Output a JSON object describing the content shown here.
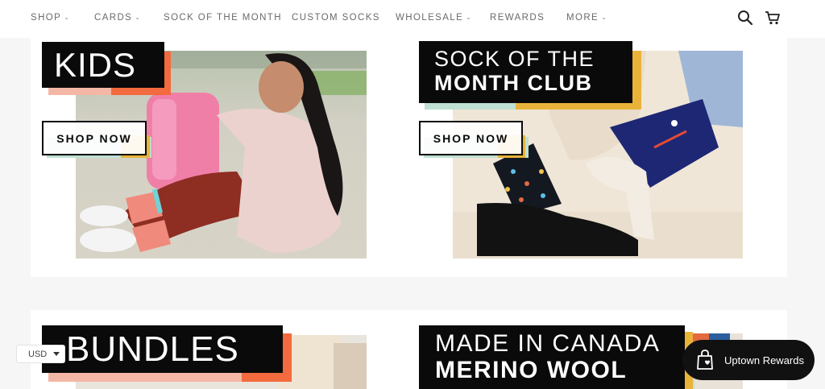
{
  "nav": {
    "items": [
      {
        "label": "SHOP",
        "dropdown": true
      },
      {
        "label": "CARDS",
        "dropdown": true
      },
      {
        "label": "SOCK OF THE MONTH",
        "dropdown": false
      },
      {
        "label": "CUSTOM SOCKS",
        "dropdown": false
      },
      {
        "label": "WHOLESALE",
        "dropdown": true
      },
      {
        "label": "REWARDS",
        "dropdown": false
      },
      {
        "label": "MORE",
        "dropdown": true
      }
    ],
    "icons": [
      "search-icon",
      "cart-icon"
    ]
  },
  "tiles": {
    "kids": {
      "title": "KIDS",
      "cta": "SHOP NOW"
    },
    "sotm": {
      "title_line1": "SOCK OF THE",
      "title_line2": "MONTH CLUB",
      "cta": "SHOP NOW"
    },
    "bundles": {
      "title": "BUNDLES"
    },
    "canada": {
      "title_line1": "MADE IN CANADA",
      "title_line2": "MERINO WOOL"
    }
  },
  "currency": {
    "value": "USD"
  },
  "rewards": {
    "label": "Uptown Rewards"
  },
  "colors": {
    "black": "#0a0a0a",
    "orange": "#f26a3d",
    "peach": "#f4b7a6",
    "yellow": "#e9b33a",
    "mint": "#bfe0d2",
    "nav_text": "#6a6a6a"
  }
}
